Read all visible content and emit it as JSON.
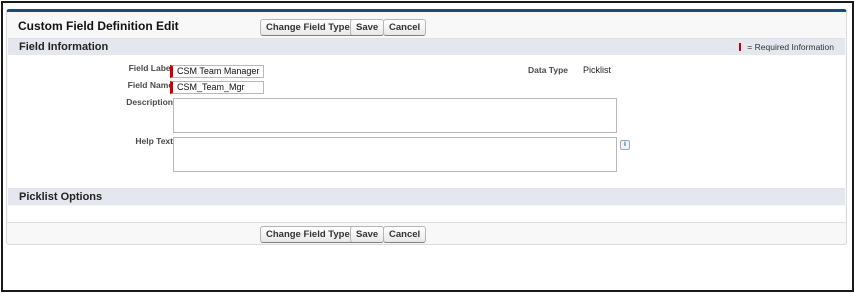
{
  "header": {
    "title": "Custom Field Definition Edit",
    "buttons": {
      "change_field_type": "Change Field Type",
      "save": "Save",
      "cancel": "Cancel"
    }
  },
  "field_information": {
    "title": "Field Information",
    "required_legend": "= Required Information",
    "field_label": {
      "label": "Field Label",
      "value": "CSM Team Manager"
    },
    "field_name": {
      "label": "Field Name",
      "value": "CSM_Team_Mgr"
    },
    "data_type": {
      "label": "Data Type",
      "value": "Picklist"
    },
    "description": {
      "label": "Description",
      "value": ""
    },
    "help_text": {
      "label": "Help Text",
      "value": ""
    },
    "help_icon_glyph": "i"
  },
  "picklist_options": {
    "title": "Picklist Options"
  },
  "footer": {
    "buttons": {
      "change_field_type": "Change Field Type",
      "save": "Save",
      "cancel": "Cancel"
    }
  },
  "colors": {
    "header_border": "#1f497d",
    "section_bg": "#e4e7ee",
    "required": "#cc0000"
  }
}
